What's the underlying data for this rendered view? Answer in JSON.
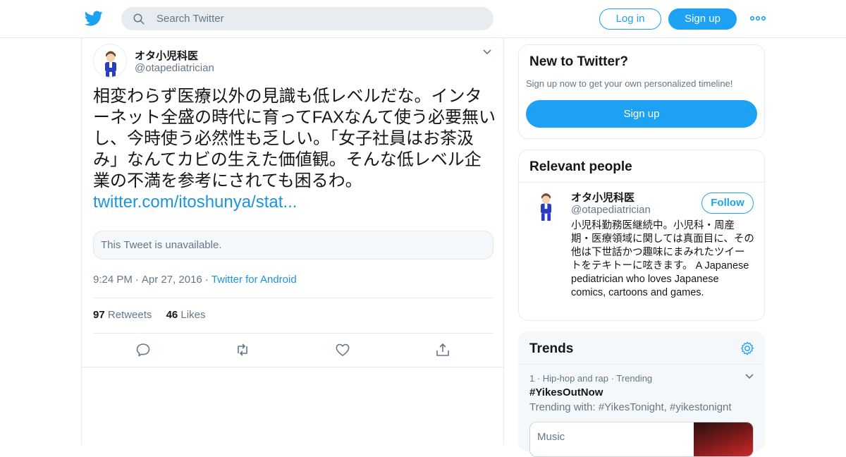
{
  "topbar": {
    "search_placeholder": "Search Twitter",
    "login_label": "Log in",
    "signup_label": "Sign up"
  },
  "tweet": {
    "author_name": "オタ小児科医",
    "author_handle": "@otapediatrician",
    "text": "相変わらず医療以外の見識も低レベルだな。インターネット全盛の時代に育ってFAXなんて使う必要無いし、今時使う必然性も乏しい。「女子社員はお茶汲み」なんてカビの生えた価値観。そんな低レベル企業の不満を参考にされても困るわ。",
    "link": "twitter.com/itoshunya/stat...",
    "quoted_unavailable": "This Tweet is unavailable.",
    "time": "9:24 PM",
    "date": "Apr 27, 2016",
    "source": "Twitter for Android",
    "retweets_count": "97",
    "retweets_label": "Retweets",
    "likes_count": "46",
    "likes_label": "Likes"
  },
  "new_to_twitter": {
    "title": "New to Twitter?",
    "subtitle": "Sign up now to get your own personalized timeline!",
    "signup_label": "Sign up"
  },
  "relevant_people": {
    "title": "Relevant people",
    "name": "オタ小児科医",
    "handle": "@otapediatrician",
    "follow_label": "Follow",
    "bio": "小児科勤務医継続中。小児科・周産期・医療領域に関しては真面目に、その他は下世話かつ趣味にまみれたツイートをテキトーに呟きます。 A Japanese pediatrician who loves Japanese comics, cartoons and games."
  },
  "trends": {
    "title": "Trends",
    "item_meta": "1 · Hip-hop and rap · Trending",
    "item_tag": "#YikesOutNow",
    "item_with": "Trending with: #YikesTonight, #yikestonignt",
    "media_label": "Music"
  },
  "colors": {
    "accent": "#1da1f2",
    "link": "#1b95e0",
    "secondary_text": "#657786"
  }
}
